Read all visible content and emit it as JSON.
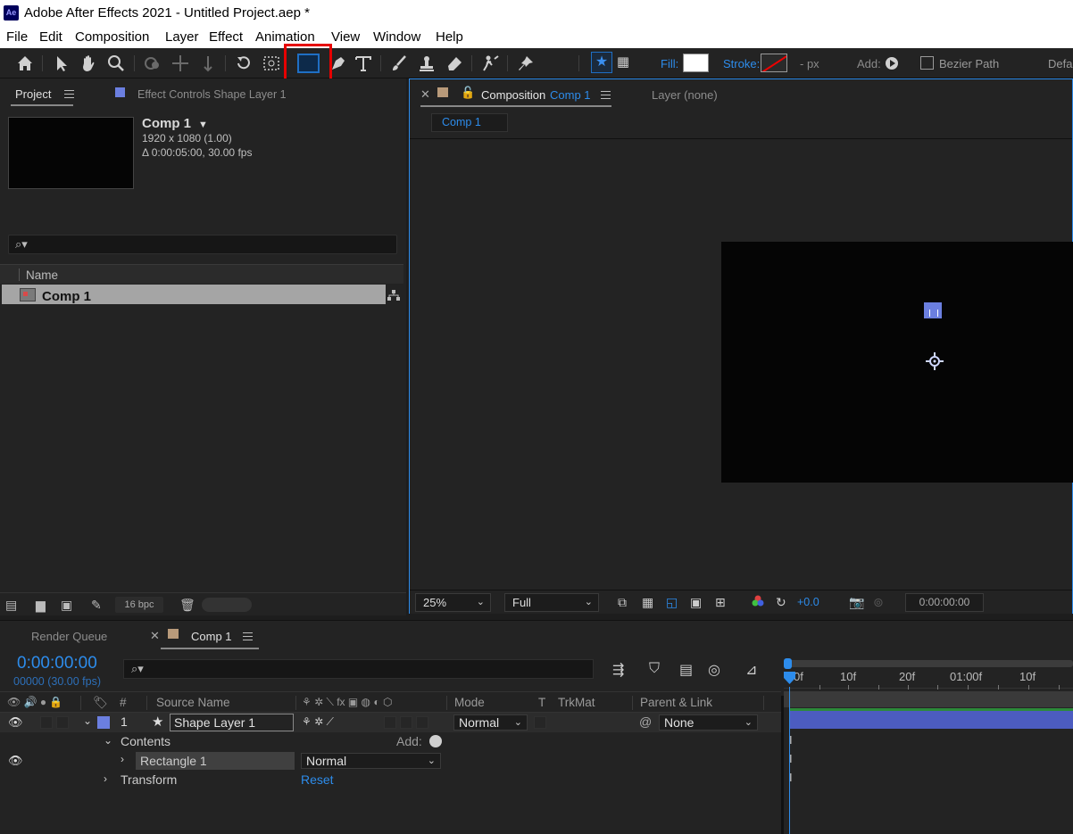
{
  "app": {
    "icon_label": "Ae",
    "title": "Adobe After Effects 2021 - Untitled Project.aep *"
  },
  "menu": [
    "File",
    "Edit",
    "Composition",
    "Layer",
    "Effect",
    "Animation",
    "View",
    "Window",
    "Help"
  ],
  "toolbar": {
    "tools": [
      "home-icon",
      "selection-tool-icon",
      "hand-tool-icon",
      "zoom-tool-icon",
      "orbit-camera-icon",
      "pan-camera-icon",
      "dolly-camera-icon",
      "rotation-tool-icon",
      "pan-behind-icon",
      "rectangle-tool-icon",
      "pen-tool-icon",
      "type-tool-icon",
      "brush-tool-icon",
      "clone-stamp-icon",
      "eraser-tool-icon",
      "roto-brush-icon",
      "puppet-pin-icon"
    ],
    "fill_label": "Fill:",
    "stroke_label": "Stroke:",
    "stroke_width": "- px",
    "add_label": "Add:",
    "bezier_label": "Bezier Path",
    "default_label": "Defa",
    "fill_color": "#ffffff",
    "highlight_color": "#e60000"
  },
  "project": {
    "tab_label": "Project",
    "effect_controls_label": "Effect Controls",
    "effect_controls_layer": "Shape Layer 1",
    "comp_name": "Comp 1",
    "comp_size": "1920 x 1080 (1.00)",
    "comp_duration": "Δ 0:00:05:00, 30.00 fps",
    "search_icon": "⌕▾",
    "col_name": "Name",
    "items": [
      {
        "name": "Comp 1"
      }
    ],
    "bpc": "16 bpc"
  },
  "composition": {
    "tab_label": "Composition",
    "tab_comp": "Comp 1",
    "layer_tab": "Layer (none)",
    "breadcrumb": "Comp 1",
    "zoom": "25%",
    "resolution": "Full",
    "exposure": "+0.0",
    "timecode": "0:00:00:00"
  },
  "timeline": {
    "render_queue": "Render Queue",
    "tab_label": "Comp 1",
    "timecode": "0:00:00:00",
    "timecode_sub": "00000 (30.00 fps)",
    "search_icon": "⌕▾",
    "headers": {
      "num": "#",
      "source": "Source Name",
      "mode": "Mode",
      "t": "T",
      "trkmat": "TrkMat",
      "parent": "Parent & Link"
    },
    "layer": {
      "num": "1",
      "name": "Shape Layer 1",
      "mode": "Normal",
      "parent": "None",
      "color": "#6b7fe0"
    },
    "contents_label": "Contents",
    "add_label": "Add:",
    "rect_label": "Rectangle 1",
    "rect_mode": "Normal",
    "transform_label": "Transform",
    "reset_label": "Reset",
    "ruler": [
      "0f",
      "10f",
      "20f",
      "01:00f",
      "10f"
    ]
  }
}
